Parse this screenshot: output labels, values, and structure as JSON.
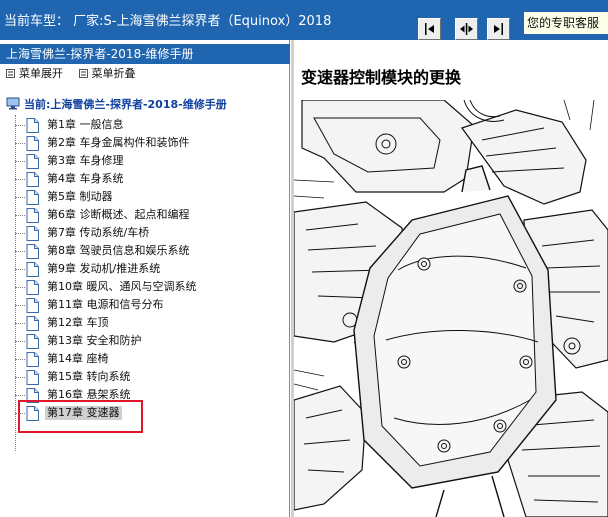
{
  "header": {
    "vehicle_label": "当前车型： 厂家:S-上海雪佛兰探界者（Equinox）2018",
    "service_label": "您的专职客服",
    "buttons": [
      {
        "name": "previous-button",
        "icon": "arrow-left-icon"
      },
      {
        "name": "expand-panes-button",
        "icon": "arrows-apart-icon"
      },
      {
        "name": "next-button",
        "icon": "arrow-right-icon"
      }
    ]
  },
  "sidebar": {
    "title": "上海雪佛兰-探界者-2018-维修手册",
    "expand_label": "菜单展开",
    "collapse_label": "菜单折叠",
    "tree_root": "当前:上海雪佛兰-探界者-2018-维修手册",
    "chapters": [
      "第1章 一般信息",
      "第2章 车身金属构件和装饰件",
      "第3章 车身修理",
      "第4章 车身系统",
      "第5章 制动器",
      "第6章 诊断概述、起点和编程",
      "第7章 传动系统/车桥",
      "第8章 驾驶员信息和娱乐系统",
      "第9章 发动机/推进系统",
      "第10章 暖风、通风与空调系统",
      "第11章 电源和信号分布",
      "第12章 车顶",
      "第13章 安全和防护",
      "第14章 座椅",
      "第15章 转向系统",
      "第16章 悬架系统",
      "第17章 变速器"
    ],
    "selected_index": 16
  },
  "content": {
    "title": "变速器控制模块的更换"
  },
  "colors": {
    "header_bg": "#1f65b0",
    "selection_box": "#e0192a",
    "service_bg": "#fbffe8"
  }
}
